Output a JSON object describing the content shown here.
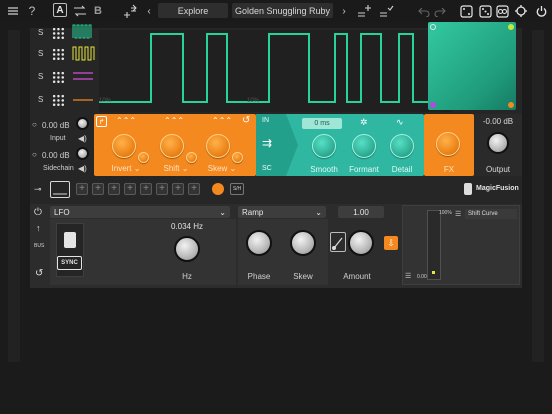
{
  "toolbar": {
    "help_label": "?",
    "a_label": "A",
    "b_label": "B",
    "prev_arrow": "‹",
    "explore_label": "Explore",
    "preset_name": "Golden Snuggling Ruby",
    "next_arrow": "›"
  },
  "sequencer": {
    "rows": [
      {
        "label": "S"
      },
      {
        "label": "S"
      },
      {
        "label": "S"
      },
      {
        "label": "S"
      }
    ],
    "wave_marker_1": "10%",
    "wave_marker_2": "10%"
  },
  "io": {
    "input_db": "0.00 dB",
    "input_label": "Input",
    "sidechain_db": "0.00 dB",
    "sidechain_label": "Sidechain"
  },
  "orange_module": {
    "knobs": [
      {
        "label": "Invert"
      },
      {
        "label": "Shift"
      },
      {
        "label": "Skew"
      }
    ]
  },
  "teal_module": {
    "in_label": "IN",
    "time_value": "0 ms",
    "sc_label": "SC",
    "knobs": [
      {
        "label": "Smooth"
      },
      {
        "label": "Formant"
      },
      {
        "label": "Detail"
      }
    ]
  },
  "fx_module": {
    "label": "FX"
  },
  "output": {
    "db": "-0.00 dB",
    "label": "Output"
  },
  "brand": {
    "name": "MagicFusion"
  },
  "lfo": {
    "type": "LFO",
    "rate_value": "0.034 Hz",
    "rate_label": "Hz",
    "sync_label": "SYNC"
  },
  "ramp": {
    "type": "Ramp",
    "knobs": [
      {
        "label": "Phase"
      },
      {
        "label": "Skew"
      }
    ]
  },
  "amount": {
    "value": "1.00",
    "label": "Amount"
  },
  "shift_curve": {
    "title": "Shift Curve",
    "top_pct": "100%",
    "bottom_pct": "0.00"
  },
  "side_labels": {
    "bus": "BUS",
    "sidechain_tag": "S/H"
  },
  "colors": {
    "orange": "#f3891f",
    "teal": "#2fb7a2",
    "wave": "#27d39a",
    "yellow": "#e6e63a"
  }
}
